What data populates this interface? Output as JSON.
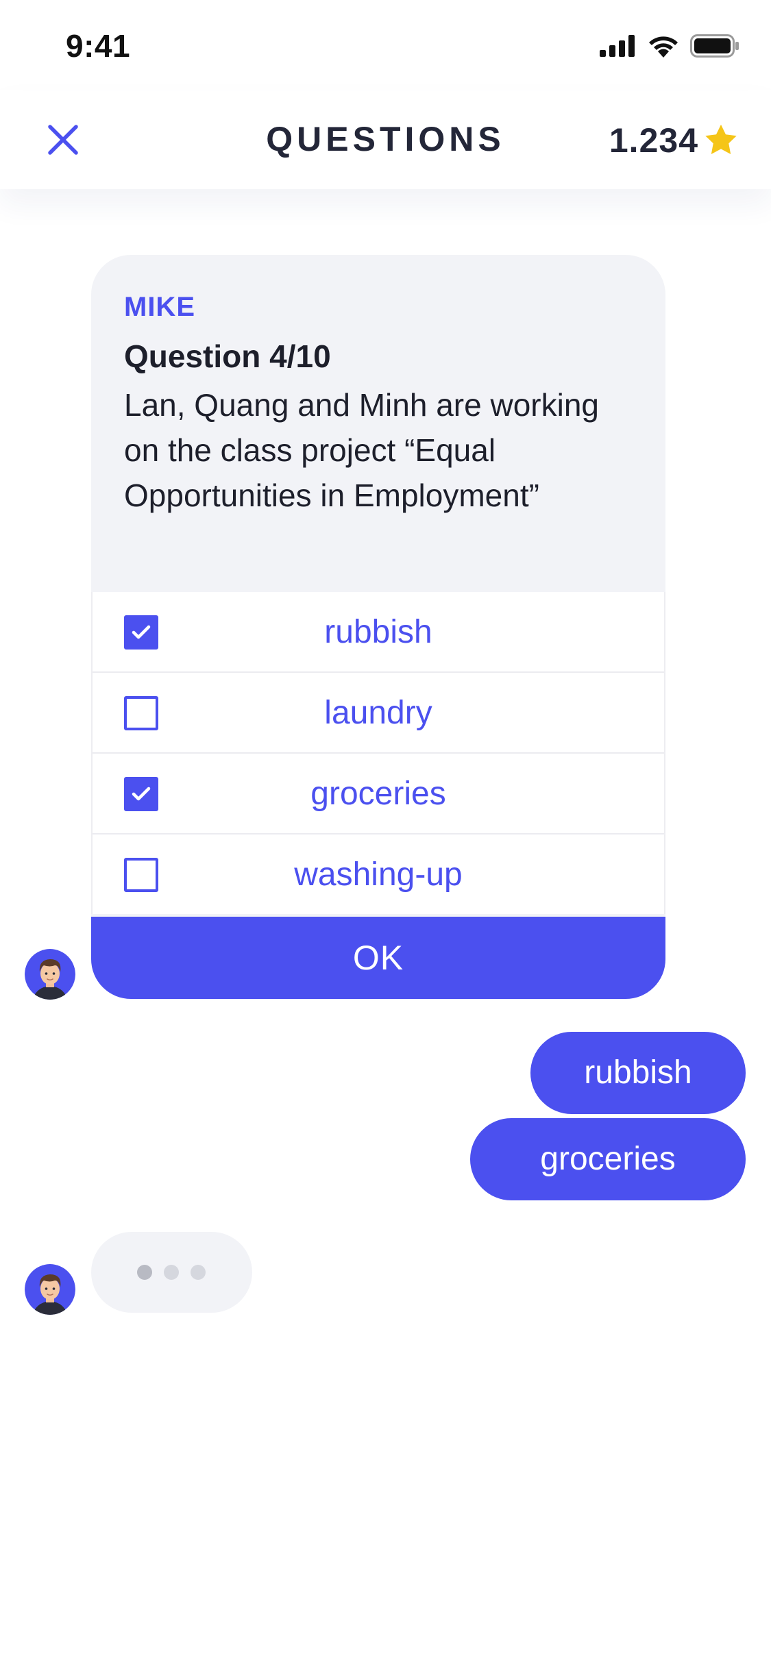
{
  "status_bar": {
    "time": "9:41"
  },
  "header": {
    "title": "QUESTIONS",
    "score": "1.234",
    "close_icon": "close-icon",
    "score_icon": "star-icon"
  },
  "question_card": {
    "sender": "MIKE",
    "question_number": "Question 4/10",
    "question_text": "Lan, Quang and Minh are working on the class project “Equal Opportunities in Employment”",
    "options": [
      {
        "label": "rubbish",
        "checked": true
      },
      {
        "label": "laundry",
        "checked": false
      },
      {
        "label": "groceries",
        "checked": true
      },
      {
        "label": "washing-up",
        "checked": false
      }
    ],
    "ok_label": "OK"
  },
  "replies": [
    {
      "text": "rubbish"
    },
    {
      "text": "groceries"
    }
  ],
  "colors": {
    "accent": "#4b50ef",
    "card_background": "#f2f3f7",
    "star": "#f5c518"
  }
}
